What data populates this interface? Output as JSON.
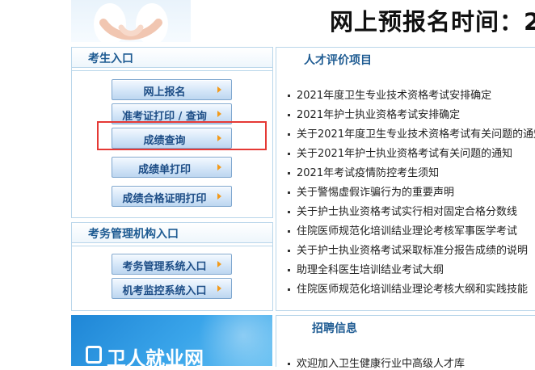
{
  "banner": {
    "title": "网上预报名时间：2"
  },
  "candidate_panel": {
    "title": "考生入口",
    "buttons": [
      {
        "label": "网上报名"
      },
      {
        "label": "准考证打印 / 查询"
      },
      {
        "label": "成绩查询"
      },
      {
        "label": "成绩单打印"
      },
      {
        "label": "成绩合格证明打印"
      }
    ]
  },
  "exam_admin_panel": {
    "title": "考务管理机构入口",
    "buttons": [
      {
        "label": "考务管理系统入口"
      },
      {
        "label": "机考监控系统入口"
      }
    ]
  },
  "promo": {
    "text": "卫人就业网"
  },
  "talent_section": {
    "title": "人才评价项目",
    "items": [
      "2021年度卫生专业技术资格考试安排确定",
      "2021年护士执业资格考试安排确定",
      "关于2021年度卫生专业技术资格考试有关问题的通知",
      "关于2021年护士执业资格考试有关问题的通知",
      "2021年考试疫情防控考生须知",
      "关于警惕虚假诈骗行为的重要声明",
      "关于护士执业资格考试实行相对固定合格分数线",
      "住院医师规范化培训结业理论考核军事医学考试",
      "关于护士执业资格考试采取标准分报告成绩的说明",
      "助理全科医生培训结业考试大纲",
      "住院医师规范化培训结业理论考核大纲和实践技能"
    ]
  },
  "recruit_section": {
    "title": "招聘信息",
    "items": [
      "欢迎加入卫生健康行业中高级人才库"
    ]
  },
  "colors": {
    "accent": "#1e5b92",
    "highlight": "#e53935",
    "arrow": "#f39a1a"
  }
}
